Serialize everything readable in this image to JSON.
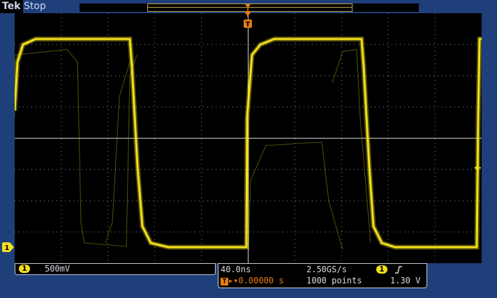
{
  "header": {
    "brand": "Tek",
    "run_state": "Stop",
    "trigger_label": "T"
  },
  "channel": {
    "number": "1",
    "scale": "500mV",
    "color": "#f4e11a"
  },
  "horizontal": {
    "time_per_div": "40.0ns",
    "sample_rate": "2.50GS/s",
    "delay": "0.00000 s",
    "record_length": "1000 points",
    "trigger_source": "1",
    "trigger_level": "1.30 V"
  },
  "colors": {
    "trace": "#f4e11a",
    "trigger": "#e57c12",
    "chrome": "#1f3f7a",
    "grid": "#8a8a8a"
  },
  "icons": {
    "trigger_marker": "trigger-position-icon",
    "edge": "rising-edge-icon",
    "level_arrow": "trigger-level-arrow-icon",
    "ground_marker": "channel-1-ground-icon"
  }
}
